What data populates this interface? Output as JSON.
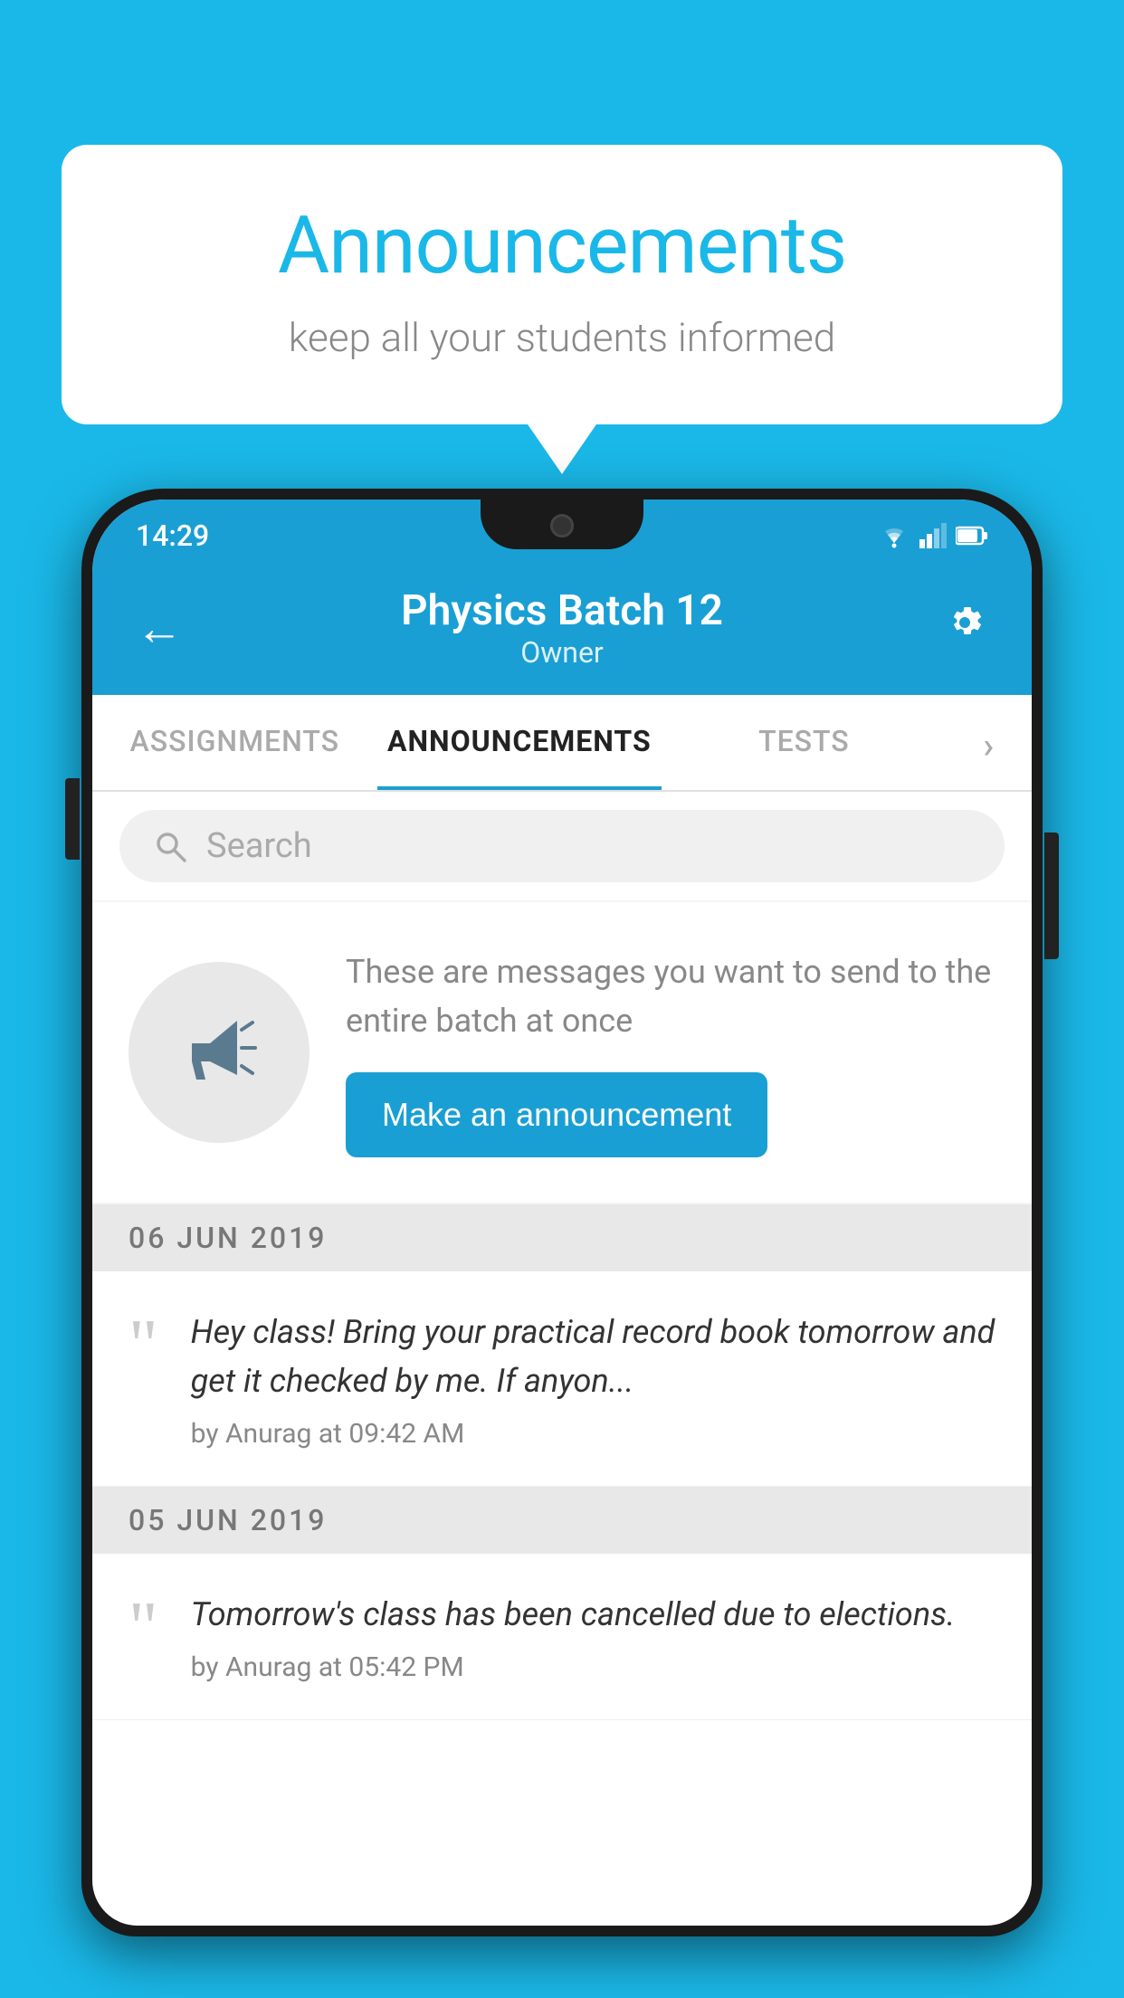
{
  "background_color": "#1ab8e8",
  "speech_bubble": {
    "title": "Announcements",
    "subtitle": "keep all your students informed"
  },
  "phone": {
    "status_bar": {
      "time": "14:29"
    },
    "header": {
      "title": "Physics Batch 12",
      "subtitle": "Owner",
      "back_label": "←",
      "gear_label": "⚙"
    },
    "tabs": [
      {
        "label": "ASSIGNMENTS",
        "active": false
      },
      {
        "label": "ANNOUNCEMENTS",
        "active": true
      },
      {
        "label": "TESTS",
        "active": false
      },
      {
        "label": "•",
        "active": false
      }
    ],
    "search": {
      "placeholder": "Search"
    },
    "promo": {
      "description": "These are messages you want to send to the entire batch at once",
      "button_label": "Make an announcement"
    },
    "announcements": [
      {
        "date": "06  JUN  2019",
        "text": "Hey class! Bring your practical record book tomorrow and get it checked by me. If anyon...",
        "author": "by Anurag at 09:42 AM"
      },
      {
        "date": "05  JUN  2019",
        "text": "Tomorrow's class has been cancelled due to elections.",
        "author": "by Anurag at 05:42 PM"
      }
    ]
  }
}
